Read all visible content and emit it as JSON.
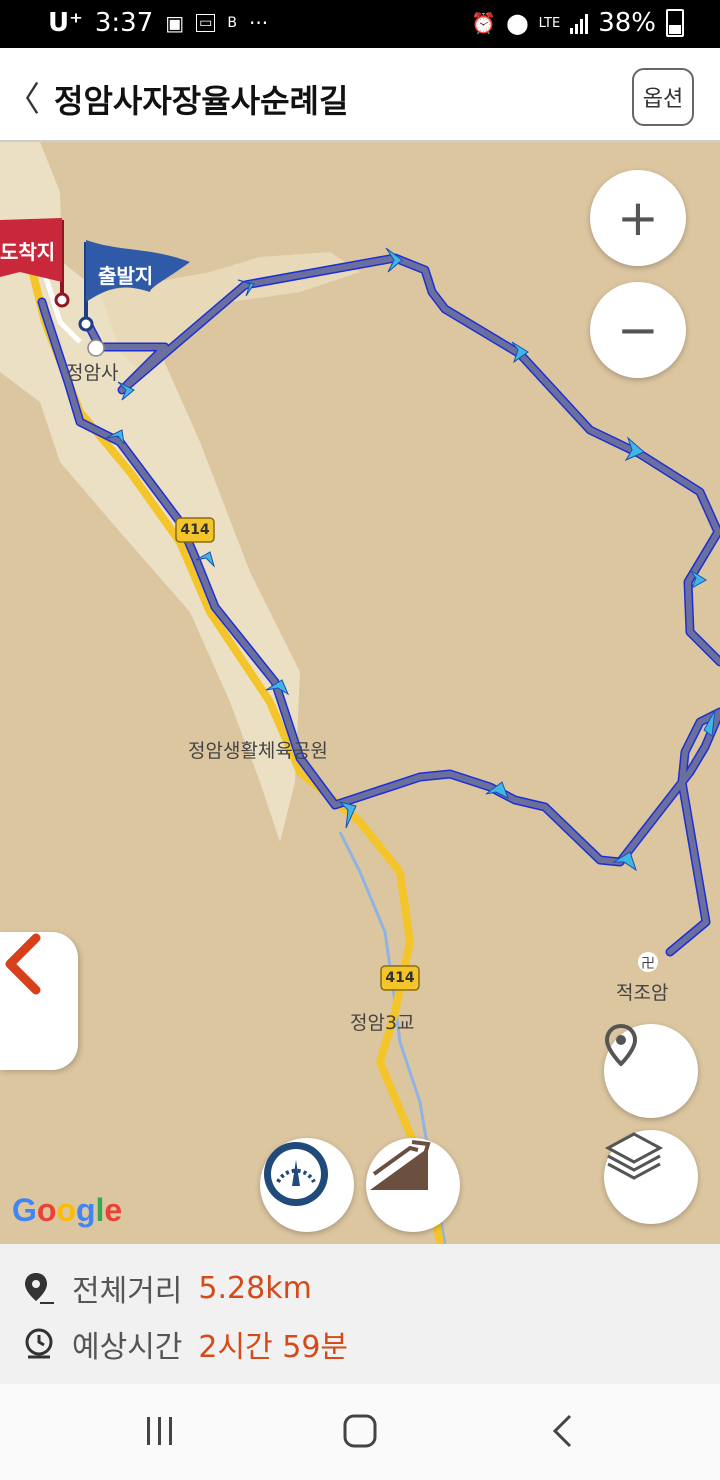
{
  "status_bar": {
    "carrier": "U⁺",
    "time": "3:37",
    "network": "LTE",
    "battery": "38%",
    "notification_icons": [
      "image-icon",
      "tv-blast-icon",
      "b612-icon",
      "more-icon"
    ],
    "status_icons": [
      "alarm-icon",
      "location-icon",
      "signal-icon",
      "battery-icon"
    ]
  },
  "header": {
    "back_label": "〈",
    "title": "정암사자장율사순례길",
    "options_label": "옵션"
  },
  "map": {
    "start_flag": "출발지",
    "end_flag": "도착지",
    "labels": {
      "temple": "정암사",
      "park": "정암생활체육공원",
      "bridge": "정암3교",
      "hermitage": "적조암"
    },
    "road_badges": [
      "414",
      "414"
    ],
    "zoom_in": "+",
    "zoom_out": "−",
    "attribution": "Google",
    "colors": {
      "route": "#6b6f9e",
      "route_edge": "#1c2fd6",
      "arrow": "#3fb6e6",
      "start_flag": "#2e5aa8",
      "end_flag": "#c8283a",
      "road": "#f4c52a",
      "river": "#8fb3e3"
    }
  },
  "info": {
    "distance_label": "전체거리",
    "distance_value": "5.28km",
    "time_label": "예상시간",
    "time_value": "2시간 59분"
  },
  "nav_bar": {
    "buttons": [
      "recent-apps-icon",
      "home-icon",
      "back-icon"
    ]
  }
}
